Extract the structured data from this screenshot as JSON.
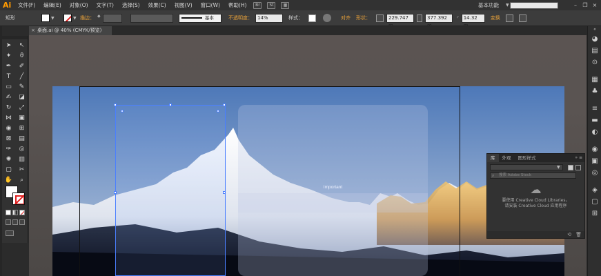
{
  "app": {
    "logo": "Ai"
  },
  "menubar": {
    "items": [
      "文件(F)",
      "编辑(E)",
      "对象(O)",
      "文字(T)",
      "选择(S)",
      "效果(C)",
      "视图(V)",
      "窗口(W)",
      "帮助(H)"
    ],
    "icon1": "Br",
    "icon2": "St",
    "workspace": "基本功能",
    "win_minimize": "–",
    "win_restore": "❐",
    "win_close": "×"
  },
  "controlbar": {
    "selection_label": "矩形",
    "stroke_label": "描边：",
    "stroke_style": "基本",
    "opacity_label": "不透明度：",
    "opacity_value": "14%",
    "style_label": "样式：",
    "align_label": "对齐",
    "shape_label": "形状：",
    "width_value": "229.747 m",
    "height_value": "377.392 m",
    "radius_value": "14.32 m",
    "transform_label": "变换"
  },
  "document": {
    "tab_title": "桌面.ai @ 40% (CMYK/预览)",
    "close": "×"
  },
  "artwork": {
    "card_text": "Important"
  },
  "libraries_panel": {
    "tabs": [
      "库",
      "外观",
      "图形样式"
    ],
    "tabs_ctrl": "»  ≡",
    "search_placeholder": "搜索 Adobe Stock",
    "message_line1": "要使用 Creative Cloud Libraries，",
    "message_line2": "请安装 Creative Cloud 应用程序"
  },
  "colors": {
    "accent_orange": "#ff9a00",
    "selection_blue": "#4a7fff",
    "stroke_red": "#e02020"
  },
  "tools": {
    "icons": [
      "selection-icon",
      "direct-selection-icon",
      "magic-wand-icon",
      "lasso-icon",
      "pen-icon",
      "curvature-icon",
      "type-icon",
      "line-icon",
      "rectangle-icon",
      "paintbrush-icon",
      "shaper-icon",
      "eraser-icon",
      "rotate-icon",
      "scale-icon",
      "width-icon",
      "warp-icon",
      "shape-builder-icon",
      "perspective-icon",
      "mesh-icon",
      "gradient-icon",
      "eyedropper-icon",
      "blend-icon",
      "symbol-sprayer-icon",
      "column-graph-icon",
      "artboard-icon",
      "slice-icon",
      "hand-icon",
      "zoom-icon"
    ]
  },
  "right_strip": {
    "icons": [
      "color-icon",
      "color-guide-icon",
      "cc-libraries-icon",
      "brushes-icon",
      "symbols-icon",
      "stroke-icon",
      "gradient-panel-icon",
      "transparency-icon",
      "appearance-icon",
      "graphic-styles-icon",
      "layers-icon",
      "artboards-icon"
    ]
  }
}
